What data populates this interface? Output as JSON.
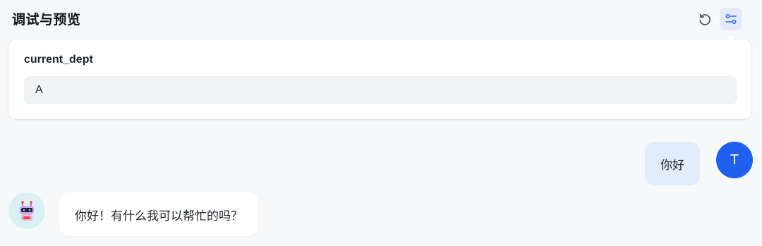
{
  "header": {
    "title": "调试与预览"
  },
  "variables": {
    "label": "current_dept",
    "value": "A"
  },
  "messages": [
    {
      "role": "user",
      "avatar_letter": "T",
      "text": "你好"
    },
    {
      "role": "bot",
      "avatar_icon": "robot-icon",
      "text": "你好！有什么我可以帮忙的吗？"
    }
  ],
  "icons": {
    "reset": "reset-icon",
    "settings": "sliders-icon"
  },
  "colors": {
    "accent": "#1f5ff0",
    "user_bubble": "#e1ecfd",
    "bot_bubble": "#ffffff",
    "settings_bg": "#e3ebfb"
  }
}
